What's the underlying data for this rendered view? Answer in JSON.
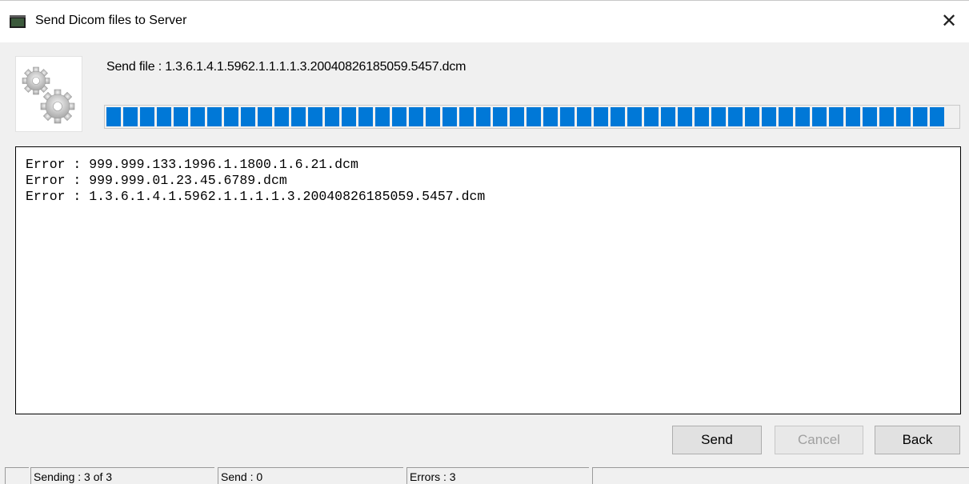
{
  "window": {
    "title": "Send Dicom files to Server",
    "close_glyph": "✕",
    "icon": "app-window-icon"
  },
  "header": {
    "icon": "gears-icon",
    "send_file_text": "Send file : 1.3.6.1.4.1.5962.1.1.1.1.3.20040826185059.5457.dcm"
  },
  "progress": {
    "fraction": 1.0,
    "color": "#0078d7"
  },
  "log": {
    "lines": [
      "Error : 999.999.133.1996.1.1800.1.6.21.dcm",
      "Error : 999.999.01.23.45.6789.dcm",
      "Error : 1.3.6.1.4.1.5962.1.1.1.1.3.20040826185059.5457.dcm"
    ]
  },
  "buttons": {
    "send": "Send",
    "cancel": "Cancel",
    "back": "Back"
  },
  "status": {
    "sending": "Sending : 3 of 3",
    "send": "Send : 0",
    "errors": "Errors : 3"
  }
}
